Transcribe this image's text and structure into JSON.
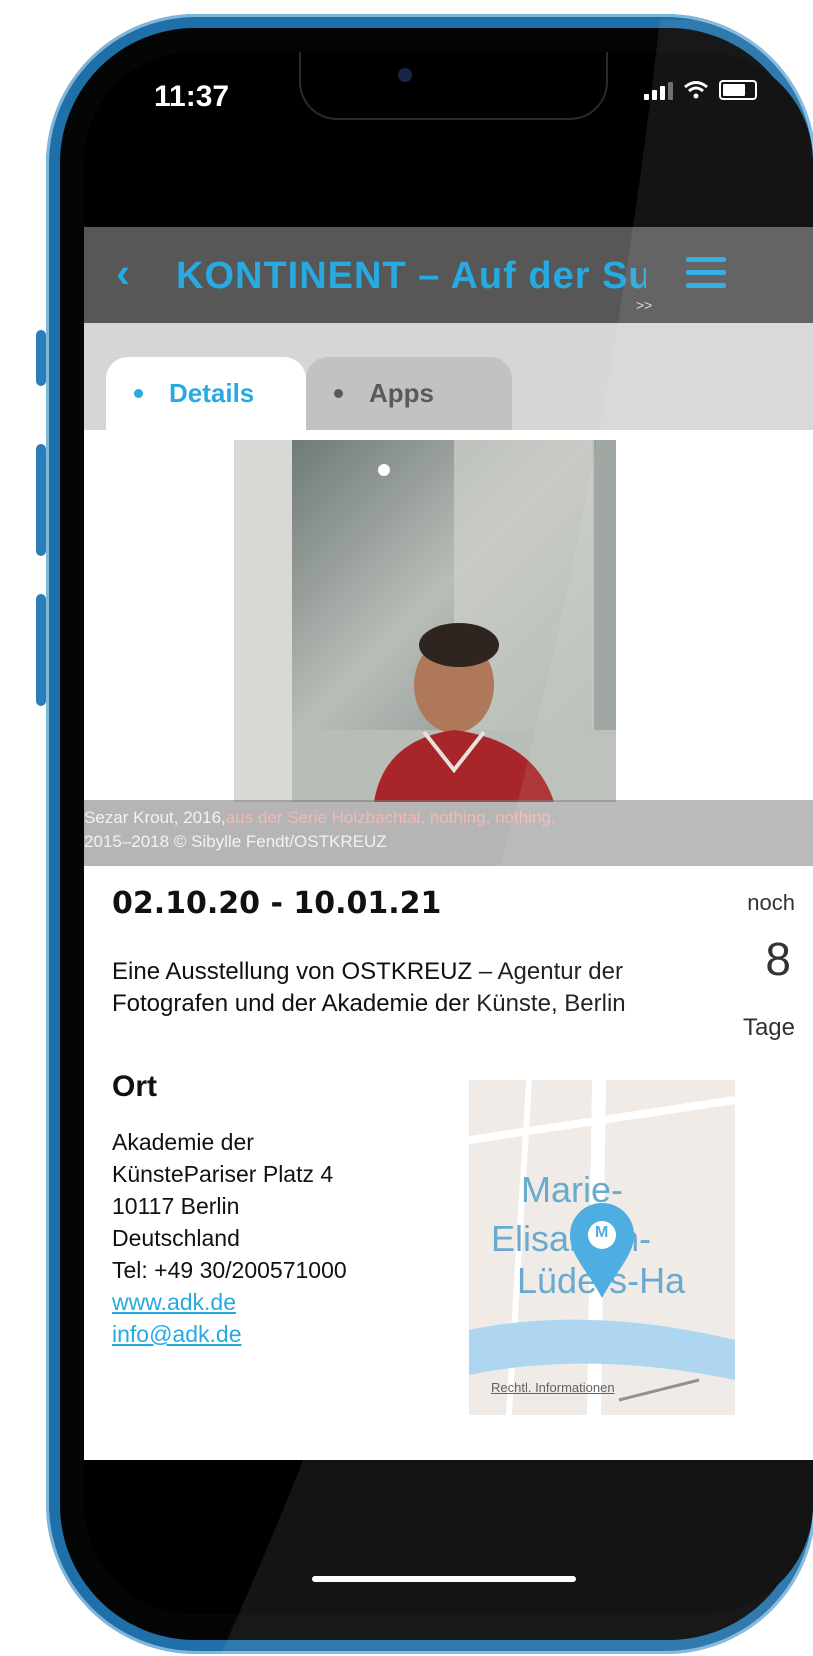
{
  "status_bar": {
    "time": "11:37"
  },
  "nav": {
    "title": "KONTINENT – Auf der Su",
    "more": ">>"
  },
  "tabs": [
    {
      "label": "Details"
    },
    {
      "label": "Apps"
    }
  ],
  "caption": {
    "line1a": "Sezar Krout, 2016,",
    "line1b": "aus der Serie Holzbachtal, nothing, nothing,",
    "line2": "2015–2018 © Sibylle Fendt/OSTKREUZ"
  },
  "event": {
    "dates": "02.10.20 - 10.01.21",
    "description": "Eine Ausstellung von OSTKREUZ – Agentur der Fotografen und der Akademie der Künste, Berlin"
  },
  "countdown": {
    "prefix": "noch",
    "days": "8",
    "suffix": "Tage"
  },
  "location": {
    "heading": "Ort",
    "lines": [
      "Akademie der",
      "KünstePariser Platz 4",
      "10117 Berlin",
      "Deutschland",
      "Tel: +49 30/200571000"
    ],
    "website": "www.adk.de",
    "email": "info@adk.de"
  },
  "map": {
    "label_line1": "Marie-",
    "label_line2": "Elisabeth-",
    "label_line3": "Lüders-Ha",
    "pin_letter": "M",
    "legal": "Rechtl. Informationen"
  },
  "colors": {
    "accent": "#27a9e1",
    "phone_frame": "#1f6fa8",
    "navbar": "#575757"
  }
}
